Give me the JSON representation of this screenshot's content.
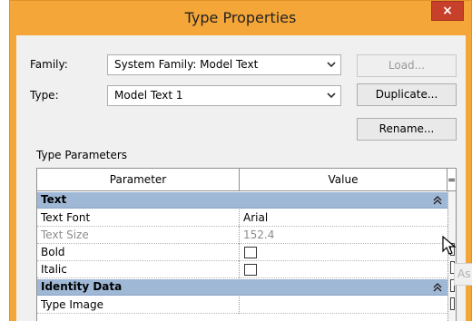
{
  "dialog": {
    "title": "Type Properties",
    "close_label": "×"
  },
  "family": {
    "label": "Family:",
    "value": "System Family: Model Text"
  },
  "type": {
    "label": "Type:",
    "value": "Model Text 1"
  },
  "buttons": {
    "load": "Load...",
    "duplicate": "Duplicate...",
    "rename": "Rename...",
    "partial": "As"
  },
  "type_parameters": {
    "heading": "Type Parameters",
    "columns": {
      "parameter": "Parameter",
      "value": "Value",
      "sort": "="
    },
    "groups": [
      {
        "name": "Text",
        "icon": "collapse-chevrons-icon",
        "rows": [
          {
            "name": "Text Font",
            "value": "Arial",
            "kind": "text",
            "dim": false
          },
          {
            "name": "Text Size",
            "value": "152.4",
            "kind": "text",
            "dim": true
          },
          {
            "name": "Bold",
            "value": "",
            "kind": "checkbox",
            "dim": false
          },
          {
            "name": "Italic",
            "value": "",
            "kind": "checkbox",
            "dim": false
          }
        ]
      },
      {
        "name": "Identity Data",
        "icon": "collapse-chevrons-icon",
        "rows": [
          {
            "name": "Type Image",
            "value": "",
            "kind": "text",
            "dim": false
          }
        ]
      }
    ]
  },
  "colors": {
    "titlebar": "#f5a638",
    "group_header": "#9fb8d6",
    "close": "#c7402a"
  }
}
